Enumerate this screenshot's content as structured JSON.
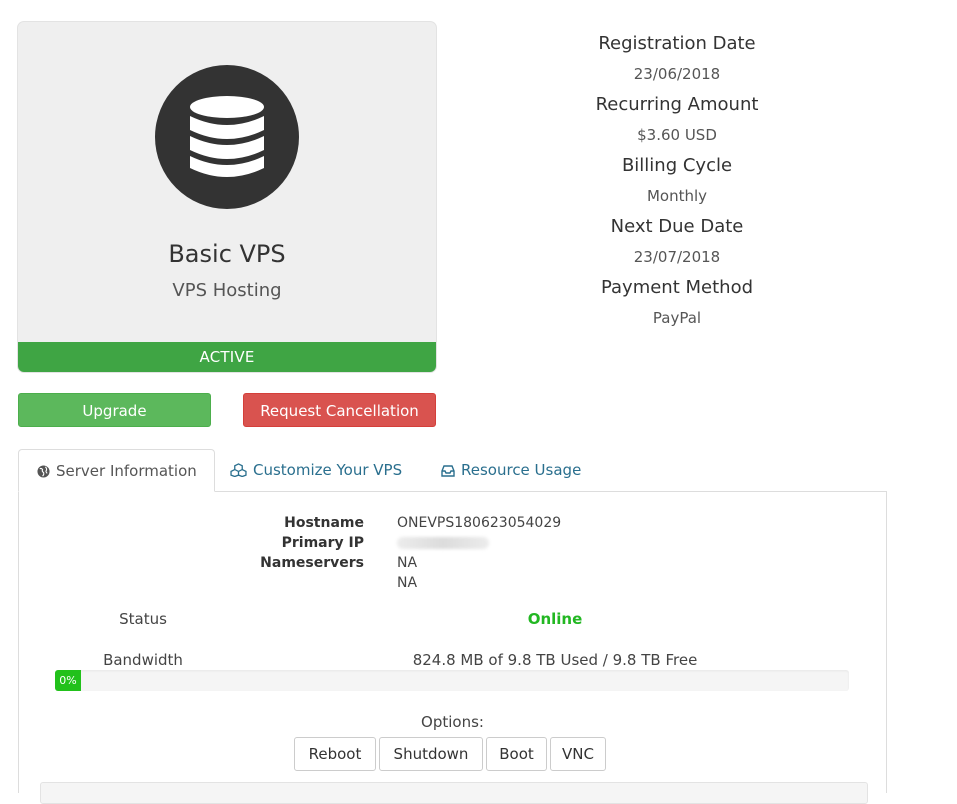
{
  "product": {
    "icon": "database-icon",
    "name": "Basic VPS",
    "group": "VPS Hosting",
    "status": "ACTIVE"
  },
  "billing": [
    {
      "label": "Registration Date",
      "value": "23/06/2018"
    },
    {
      "label": "Recurring Amount",
      "value": "$3.60 USD"
    },
    {
      "label": "Billing Cycle",
      "value": "Monthly"
    },
    {
      "label": "Next Due Date",
      "value": "23/07/2018"
    },
    {
      "label": "Payment Method",
      "value": "PayPal"
    }
  ],
  "actions": {
    "upgrade": "Upgrade",
    "cancel": "Request Cancellation"
  },
  "tabs": [
    {
      "label": "Server Information",
      "icon": "globe-icon",
      "active": true
    },
    {
      "label": "Customize Your VPS",
      "icon": "cubes-icon",
      "active": false
    },
    {
      "label": "Resource Usage",
      "icon": "inbox-icon",
      "active": false
    }
  ],
  "server": {
    "hostname_label": "Hostname",
    "hostname": "ONEVPS180623054029",
    "ip_label": "Primary IP",
    "ns_label": "Nameservers",
    "ns1": "NA",
    "ns2": "NA",
    "status_label": "Status",
    "status": "Online",
    "bandwidth_label": "Bandwidth",
    "bandwidth_text": "824.8 MB of 9.8 TB Used / 9.8 TB Free",
    "bandwidth_percent": "0%",
    "options_label": "Options:",
    "options": [
      "Reboot",
      "Shutdown",
      "Boot",
      "VNC"
    ]
  },
  "colors": {
    "active": "#3fa544",
    "upgrade": "#5cb85c",
    "cancel": "#d9534f",
    "online": "#22b722",
    "link": "#2a6f8e"
  }
}
